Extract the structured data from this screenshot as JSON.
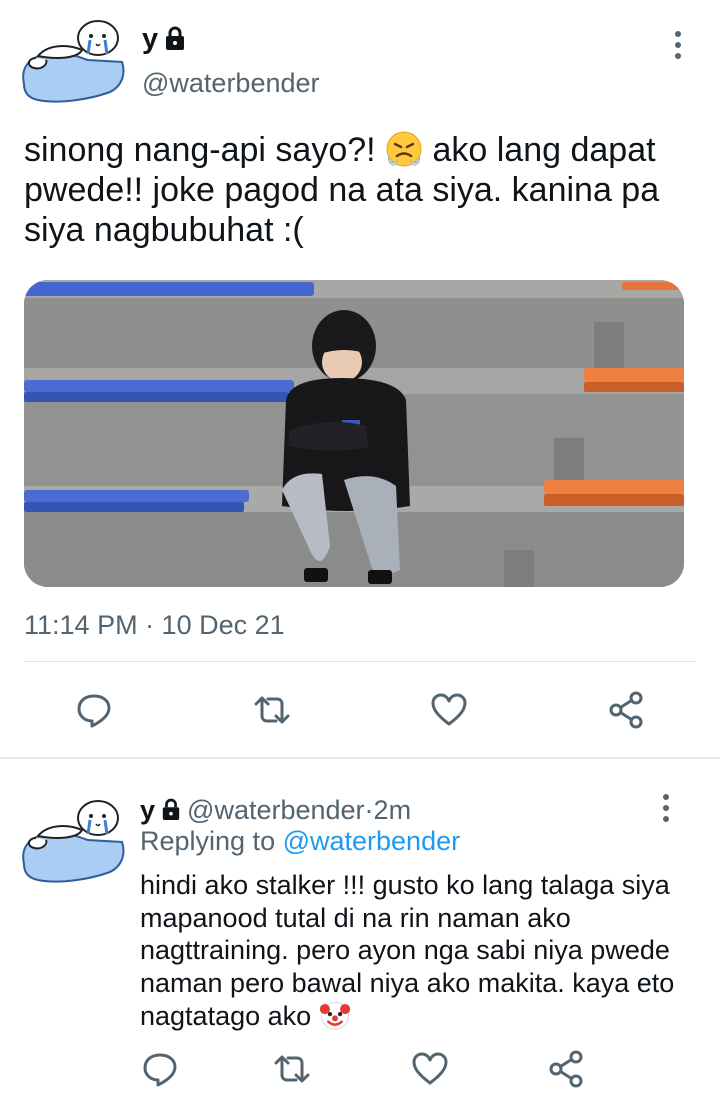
{
  "tweet": {
    "display_name": "y",
    "handle": "@waterbender",
    "text_before_emoji": "sinong nang-api sayo?! ",
    "emoji_name": "face-with-steam-emoji",
    "text_after_emoji": " ako lang dapat pwede!! joke pagod na ata siya. kanina pa siya nagbubuhat :(",
    "timestamp": "11:14 PM · 10 Dec 21",
    "photo_description_icon": "photo",
    "actions": [
      {
        "name": "reply",
        "icon": "comment-icon"
      },
      {
        "name": "retweet",
        "icon": "retweet-icon"
      },
      {
        "name": "like",
        "icon": "heart-icon"
      },
      {
        "name": "share",
        "icon": "share-icon"
      }
    ]
  },
  "reply": {
    "display_name": "y",
    "handle": "@waterbender",
    "separator": " · ",
    "age": "2m",
    "replying_prefix": "Replying to ",
    "replying_to": "@waterbender",
    "text": "hindi ako stalker !!! gusto ko lang talaga siya mapanood tutal di na rin naman ako nagttraining. pero ayon nga sabi niya pwede naman pero bawal niya ako makita. kaya eto nagtatago ako ",
    "emoji_name": "clown-emoji"
  },
  "colors": {
    "text": "#0f1419",
    "secondary": "#536471",
    "link": "#1d9bf0",
    "divider": "#dfe3e6"
  }
}
